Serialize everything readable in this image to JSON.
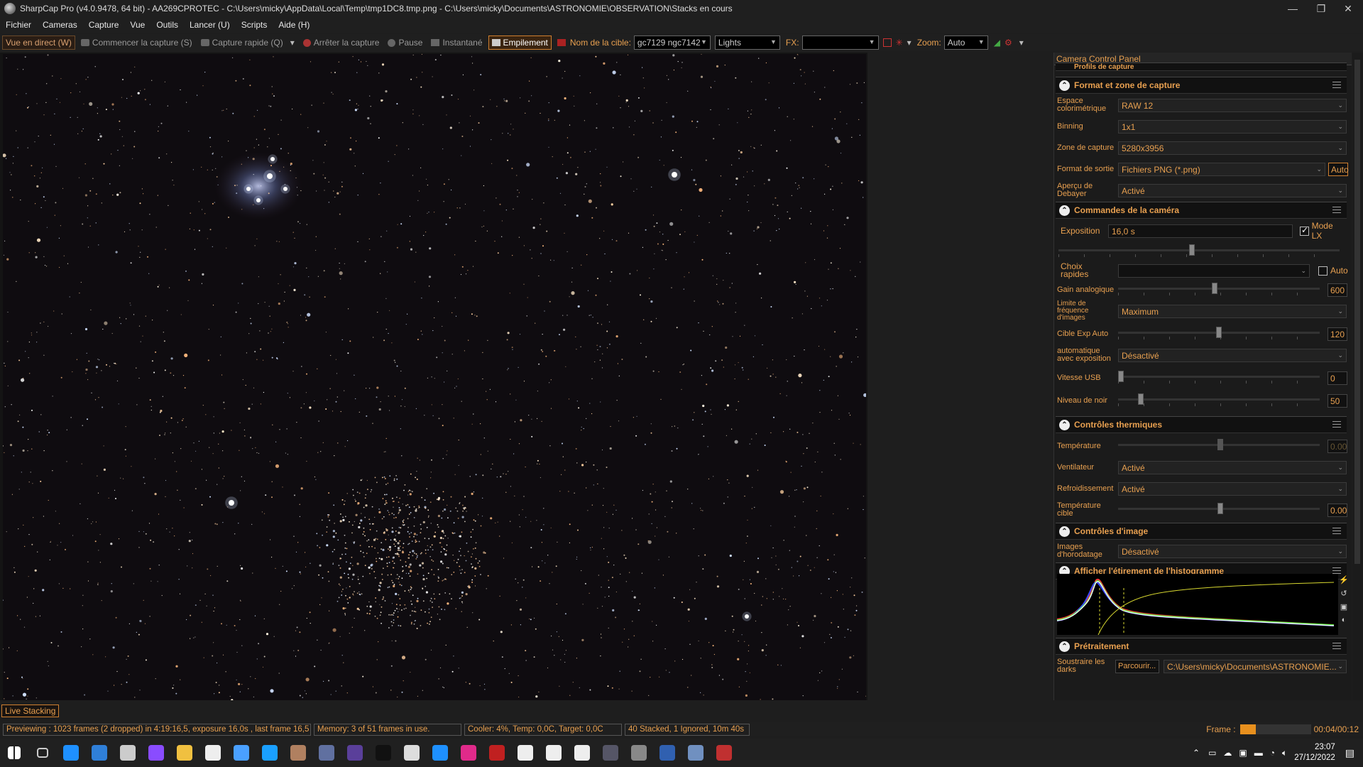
{
  "window": {
    "title": "SharpCap Pro (v4.0.9478, 64 bit) - AA269CPROTEC - C:\\Users\\micky\\AppData\\Local\\Temp\\tmp1DC8.tmp.png - C:\\Users\\micky\\Documents\\ASTRONOMIE\\OBSERVATION\\Stacks en cours",
    "minimize": "—",
    "restore": "❐",
    "close": "✕"
  },
  "menu": [
    "Fichier",
    "Cameras",
    "Capture",
    "Vue",
    "Outils",
    "Lancer (U)",
    "Scripts",
    "Aide (H)"
  ],
  "toolbar": {
    "live": "Vue en direct (W)",
    "start_capture": "Commencer la capture (S)",
    "quick_capture": "Capture rapide (Q)",
    "stop_capture": "Arrêter la capture",
    "pause": "Pause",
    "snapshot": "Instantané",
    "stacking": "Empilement",
    "target_label": "Nom de la cible:",
    "target_value": "gc7129 ngc7142",
    "frame_type": "Lights",
    "fx_label": "FX:",
    "fx_value": "",
    "zoom_label": "Zoom:",
    "zoom_value": "Auto"
  },
  "panel": {
    "title": "Camera Control Panel",
    "partial_section": "Profils de capture",
    "format": {
      "title": "Format et zone de capture",
      "color_space_label": "Espace colorimétrique",
      "color_space": "RAW 12",
      "binning_label": "Binning",
      "binning": "1x1",
      "capture_area_label": "Zone de capture",
      "capture_area": "5280x3956",
      "output_label": "Format de sortie",
      "output": "Fichiers PNG (*.png)",
      "output_auto": "Auto",
      "debayer_label": "Aperçu de Debayer",
      "debayer": "Activé"
    },
    "camera": {
      "title": "Commandes de la caméra",
      "exposure_label": "Exposition",
      "exposure": "16,0 s",
      "lx_label": "Mode LX",
      "quick_label": "Choix rapides",
      "quick_auto": "Auto",
      "gain_label": "Gain analogique",
      "gain": "600",
      "gain_level": 0.48,
      "fps_label": "Limite de fréquence d'images",
      "fps": "Maximum",
      "auto_target_label": "Cible Exp Auto",
      "auto_target": "120",
      "auto_target_level": 0.5,
      "auto_exp_label": "automatique avec exposition",
      "auto_exp": "Désactivé",
      "usb_label": "Vitesse USB",
      "usb": "0",
      "usb_level": 0.0,
      "black_label": "Niveau de noir",
      "black": "50",
      "black_level": 0.1
    },
    "thermal": {
      "title": "Contrôles thermiques",
      "temp_label": "Température",
      "temp": "0.00",
      "fan_label": "Ventilateur",
      "fan": "Activé",
      "cooling_label": "Refroidissement",
      "cooling": "Activé",
      "target_label": "Température cible",
      "target": "0.00"
    },
    "image": {
      "title": "Contrôles d'image",
      "timestamp_label": "Images d'horodatage",
      "timestamp": "Désactivé"
    },
    "histogram": {
      "title": "Afficher l'étirement de l'histogramme"
    },
    "preprocessing": {
      "title": "Prétraitement",
      "darks_label": "Soustraire les darks",
      "browse": "Parcourir...",
      "darks_path": "C:\\Users\\micky\\Documents\\ASTRONOMIE..."
    }
  },
  "live_stacking": "Live Stacking",
  "status": {
    "preview": "Previewing : 1023 frames (2 dropped) in 4:19:16,5, exposure 16,0s , last frame 16,5",
    "memory": "Memory: 3 of 51 frames in use.",
    "cooler": "Cooler: 4%, Temp: 0,0C, Target: 0,0C",
    "stack": "40 Stacked, 1 Ignored, 10m 40s",
    "frame_label": "Frame :",
    "frame_time": "00:04/00:12",
    "frame_progress": 0.22
  },
  "taskbar": {
    "time": "23:07",
    "date": "27/12/2022",
    "apps": [
      "start-icon",
      "task-view-icon",
      "edge-icon",
      "mail-icon",
      "settings-icon",
      "messenger-icon",
      "explorer-icon",
      "notepad-icon",
      "browser-icon",
      "chat-icon",
      "sky-icon",
      "photo-icon",
      "stellarium-icon",
      "pixinsight-icon",
      "window-icon",
      "asterisk-icon",
      "grid-icon",
      "comet-icon",
      "siril-icon",
      "f-icon",
      "logo-icon",
      "star-icon",
      "sharpcap-icon",
      "stack-icon",
      "image-icon",
      "telescope-icon"
    ]
  }
}
